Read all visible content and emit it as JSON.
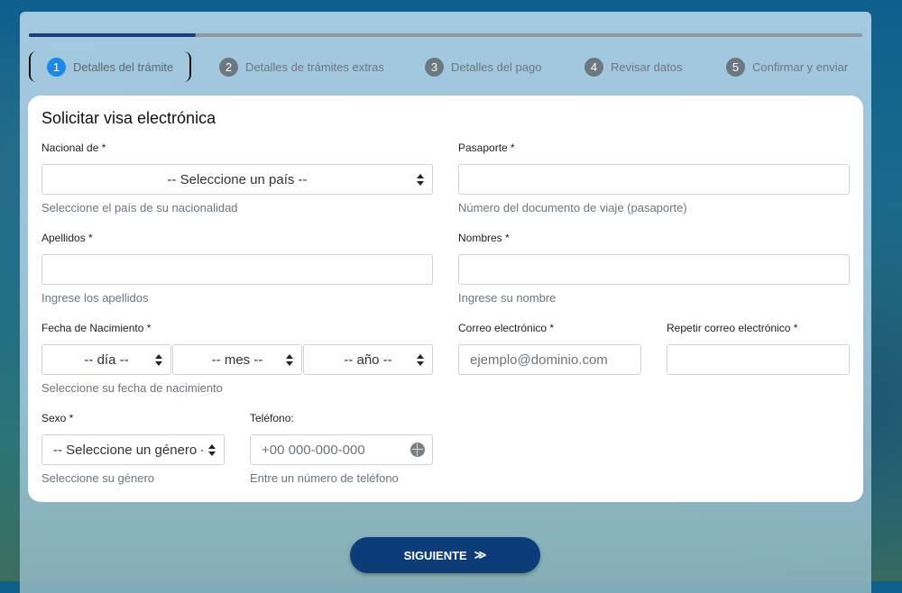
{
  "progress": {
    "current_step": 1,
    "total_steps": 5,
    "fraction": 0.2
  },
  "steps": [
    {
      "num": "1",
      "label": "Detalles del trámite"
    },
    {
      "num": "2",
      "label": "Detalles de trámites extras"
    },
    {
      "num": "3",
      "label": "Detalles del pago"
    },
    {
      "num": "4",
      "label": "Revisar datos"
    },
    {
      "num": "5",
      "label": "Confirmar y enviar"
    }
  ],
  "form": {
    "title": "Solicitar visa electrónica",
    "nationality": {
      "label": "Nacional de *",
      "value": "-- Seleccione un país --",
      "help": "Seleccione el país de su nacionalidad"
    },
    "passport": {
      "label": "Pasaporte *",
      "value": "",
      "help": "Número del documento de viaje (pasaporte)"
    },
    "surnames": {
      "label": "Apellidos *",
      "value": "",
      "help": "Ingrese los apellidos"
    },
    "names": {
      "label": "Nombres *",
      "value": "",
      "help": "Ingrese su nombre"
    },
    "birthdate": {
      "label": "Fecha de Nacimiento *",
      "day": "-- día --",
      "month": "-- mes --",
      "year": "-- año --",
      "help": "Seleccione su fecha de nacimiento"
    },
    "email": {
      "label": "Correo electrónico *",
      "placeholder": "ejemplo@dominio.com"
    },
    "email_repeat": {
      "label": "Repetir correo electrónico *",
      "value": ""
    },
    "sex": {
      "label": "Sexo *",
      "value": "-- Seleccione un género --",
      "help": "Seleccione su género"
    },
    "phone": {
      "label": "Teléfono:",
      "placeholder": "+00 000-000-000",
      "help": "Entre un número de teléfono"
    }
  },
  "next_button": {
    "label": "SIGUIENTE",
    "arrow": "≫"
  },
  "icons": {
    "phone_globe": "globe-icon",
    "select_caret": "caret-updown-icon",
    "next_arrow": "double-chevron-right-icon"
  },
  "colors": {
    "active_step": "#1e88e5",
    "progress_fill": "#1a3d7c",
    "next_button": "#0c3d79"
  }
}
